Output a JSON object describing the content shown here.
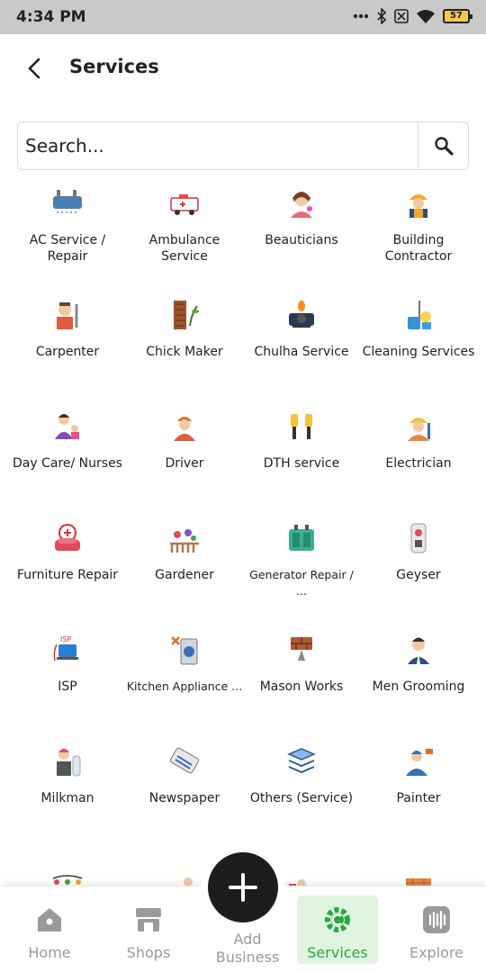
{
  "status": {
    "time": "4:34 PM",
    "battery": "57"
  },
  "header": {
    "title": "Services"
  },
  "search": {
    "placeholder": "Search..."
  },
  "services": [
    "AC Service / Repair",
    "Ambulance Service",
    "Beauticians",
    "Building Contractor",
    "Carpenter",
    "Chick Maker",
    "Chulha Service",
    "Cleaning Services",
    "Day Care/ Nurses",
    "Driver",
    "DTH service",
    "Electrician",
    "Furniture Repair",
    "Gardener",
    "Generator Repair / ...",
    "Geyser",
    "ISP",
    "Kitchen Appliance ...",
    "Mason Works",
    "Men Grooming",
    "Milkman",
    "Newspaper",
    "Others (Service)",
    "Painter"
  ],
  "icons": [
    "ac-repair-icon",
    "ambulance-icon",
    "beautician-icon",
    "building-contractor-icon",
    "carpenter-icon",
    "chick-maker-icon",
    "chulha-icon",
    "cleaning-icon",
    "day-care-icon",
    "driver-icon",
    "dth-icon",
    "electrician-icon",
    "furniture-repair-icon",
    "gardener-icon",
    "generator-icon",
    "geyser-icon",
    "isp-icon",
    "kitchen-appliance-icon",
    "mason-icon",
    "men-grooming-icon",
    "milkman-icon",
    "newspaper-icon",
    "others-icon",
    "painter-icon"
  ],
  "nav": {
    "home": "Home",
    "shops": "Shops",
    "add": "Add Business",
    "services": "Services",
    "explore": "Explore"
  },
  "colors": {
    "active_green": "#27a844",
    "active_bg": "#dff3df",
    "fab": "#1d1d1d"
  }
}
